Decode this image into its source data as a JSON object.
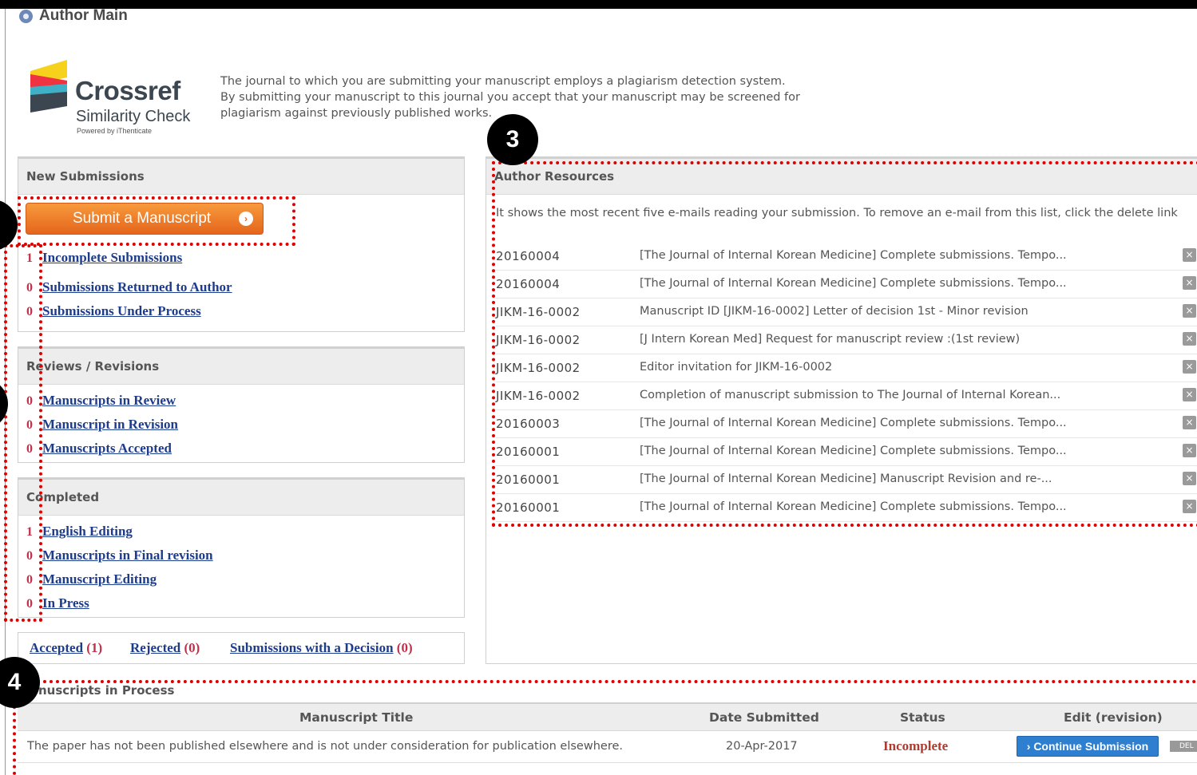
{
  "page": {
    "title": "Author Main"
  },
  "logo": {
    "brand": "Crossref",
    "subtitle": "Similarity Check",
    "powered": "Powered by iThenticate"
  },
  "notice": "The journal to which you are submitting your manuscript employs a plagiarism detection system. By submitting your manuscript to this journal you accept that your manuscript may be screened for plagiarism against previously published works.",
  "new_submissions": {
    "title": "New Submissions",
    "submit_label": "Submit a Manuscript",
    "items": [
      {
        "count": "1",
        "label": "Incomplete Submissions"
      },
      {
        "count": "0",
        "label": "Submissions Returned to Author"
      },
      {
        "count": "0",
        "label": "Submissions Under Process"
      }
    ]
  },
  "reviews": {
    "title": "Reviews / Revisions",
    "items": [
      {
        "count": "0",
        "label": "Manuscripts in Review"
      },
      {
        "count": "0",
        "label": "Manuscript in Revision"
      },
      {
        "count": "0",
        "label": "Manuscripts Accepted"
      }
    ]
  },
  "completed": {
    "title": "Completed",
    "items": [
      {
        "count": "1",
        "label": "English Editing"
      },
      {
        "count": "0",
        "label": "Manuscripts in Final revision"
      },
      {
        "count": "0",
        "label": "Manuscript Editing"
      },
      {
        "count": "0",
        "label": "In Press"
      }
    ]
  },
  "decisions": {
    "accepted_label": "Accepted",
    "accepted_count": "(1)",
    "rejected_label": "Rejected",
    "rejected_count": "(0)",
    "decision_label": "Submissions with a Decision",
    "decision_count": "(0)"
  },
  "resources": {
    "title": "Author Resources",
    "description": "It shows the most recent five e-mails reading your submission. To remove an e-mail from this list, click the delete link",
    "emails": [
      {
        "id": "20160004",
        "subject": "[The Journal of Internal Korean Medicine] Complete submissions. Tempo..."
      },
      {
        "id": "20160004",
        "subject": "[The Journal of Internal Korean Medicine] Complete submissions. Tempo..."
      },
      {
        "id": "JIKM-16-0002",
        "subject": "Manuscript ID [JIKM-16-0002] Letter of decision 1st - Minor revision"
      },
      {
        "id": "JIKM-16-0002",
        "subject": "[J Intern Korean Med] Request for manuscript review :(1st review)"
      },
      {
        "id": "JIKM-16-0002",
        "subject": "Editor invitation for JIKM-16-0002"
      },
      {
        "id": "JIKM-16-0002",
        "subject": "Completion of manuscript submission to The Journal of Internal Korean..."
      },
      {
        "id": "20160003",
        "subject": "[The Journal of Internal Korean Medicine] Complete submissions. Tempo..."
      },
      {
        "id": "20160001",
        "subject": "[The Journal of Internal Korean Medicine] Complete submissions. Tempo..."
      },
      {
        "id": "20160001",
        "subject": "[The Journal of Internal Korean Medicine] Manuscript Revision and re-..."
      },
      {
        "id": "20160001",
        "subject": "[The Journal of Internal Korean Medicine] Complete submissions. Tempo..."
      }
    ]
  },
  "process": {
    "title": "nuscripts in Process",
    "headers": {
      "title": "Manuscript Title",
      "date": "Date Submitted",
      "status": "Status",
      "edit": "Edit (revision)"
    },
    "row": {
      "title": "The paper has not been published elsewhere and is not under consideration for publication elsewhere.",
      "date": "20-Apr-2017",
      "status": "Incomplete",
      "continue_label": "› Continue Submission",
      "delete_label": "DEL"
    }
  },
  "markers": {
    "m3": "3",
    "m4": "4"
  },
  "colors": {
    "annotation": "#e00000",
    "count": "#c0304a",
    "link": "#1e3c8c",
    "button": "#e5651c",
    "continue": "#2f7fd0"
  }
}
